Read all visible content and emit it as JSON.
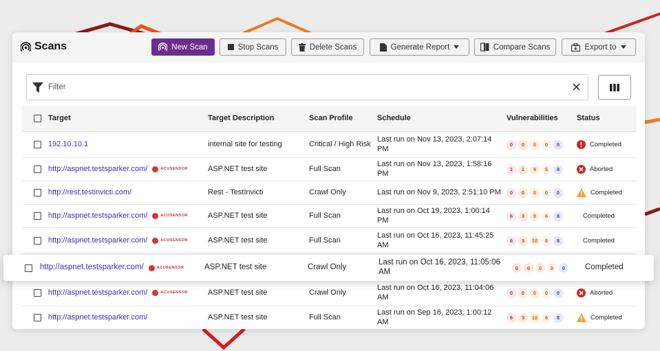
{
  "colors": {
    "brand_purple": "#6b2e8c",
    "link": "#3b2dbd",
    "critical": "#c62828",
    "warning": "#f0a030"
  },
  "header": {
    "title": "Scans",
    "title_icon": "scan-signal-icon",
    "buttons": {
      "new_scan": "New Scan",
      "stop_scans": "Stop Scans",
      "delete_scans": "Delete Scans",
      "generate_report": "Generate Report",
      "compare_scans": "Compare Scans",
      "export_to": "Export to"
    }
  },
  "filter": {
    "placeholder": "Filter",
    "value": ""
  },
  "table": {
    "columns": [
      "Target",
      "Target Description",
      "Scan Profile",
      "Schedule",
      "Vulnerabilities",
      "Status"
    ],
    "sensor_label": "ACUSENSOR",
    "rows": [
      {
        "target": "192.10.10.1",
        "sensor": false,
        "description": "internal site for testing",
        "profile": "Critical / High Risk",
        "schedule": "Last run on Nov 13, 2023, 2:07:14 PM",
        "vulns": [
          "0",
          "0",
          "0",
          "0",
          "0"
        ],
        "status": "Completed",
        "status_icon": "critical-icon"
      },
      {
        "target": "http://aspnet.testsparker.com/",
        "sensor": true,
        "description": "ASP.NET test site",
        "profile": "Full Scan",
        "schedule": "Last run on Nov 13, 2023, 1:58:16 PM",
        "vulns": [
          "1",
          "1",
          "9",
          "5",
          "8"
        ],
        "status": "Aborted",
        "status_icon": "aborted-icon"
      },
      {
        "target": "http://rest.testinvicti.com/",
        "sensor": false,
        "description": "Rest - TestInvicti",
        "profile": "Crawl Only",
        "schedule": "Last run on Nov 9, 2023, 2:51:10 PM",
        "vulns": [
          "0",
          "0",
          "0",
          "0",
          "0"
        ],
        "status": "Completed",
        "status_icon": "warning-icon"
      },
      {
        "target": "http://aspnet.testsparker.com/",
        "sensor": true,
        "description": "ASP.NET test site",
        "profile": "Full Scan",
        "schedule": "Last run on Oct 19, 2023, 1:00:14 PM",
        "vulns": [
          "6",
          "3",
          "9",
          "6",
          "8"
        ],
        "status": "Completed",
        "status_icon": ""
      },
      {
        "target": "http://aspnet.testsparker.com/",
        "sensor": true,
        "description": "ASP.NET test site",
        "profile": "Full Scan",
        "schedule": "Last run on Oct 16, 2023, 11:45:25 AM",
        "vulns": [
          "6",
          "3",
          "10",
          "6",
          "8"
        ],
        "status": "Completed",
        "status_icon": ""
      },
      {
        "target": "http://aspnet.testsparker.com/",
        "sensor": true,
        "description": "ASP.NET test site",
        "profile": "Crawl Only",
        "schedule": "Last run on Oct 16, 2023, 11:05:06 AM",
        "vulns": [
          "0",
          "0",
          "0",
          "0",
          "0"
        ],
        "status": "Completed",
        "status_icon": ""
      },
      {
        "target": "http://aspnet.testsparker.com/",
        "sensor": true,
        "description": "ASP.NET test site",
        "profile": "Crawl Only",
        "schedule": "Last run on Oct 16, 2023, 11:04:06 AM",
        "vulns": [
          "0",
          "0",
          "0",
          "0",
          "0"
        ],
        "status": "Aborted",
        "status_icon": "aborted-icon"
      },
      {
        "target": "http://aspnet.testsparker.com/",
        "sensor": false,
        "description": "ASP.NET test site",
        "profile": "Full Scan",
        "schedule": "Last run on Sep 16, 2023, 1:00:12 AM",
        "vulns": [
          "6",
          "3",
          "10",
          "6",
          "8"
        ],
        "status": "Completed",
        "status_icon": "warning-icon"
      }
    ]
  }
}
